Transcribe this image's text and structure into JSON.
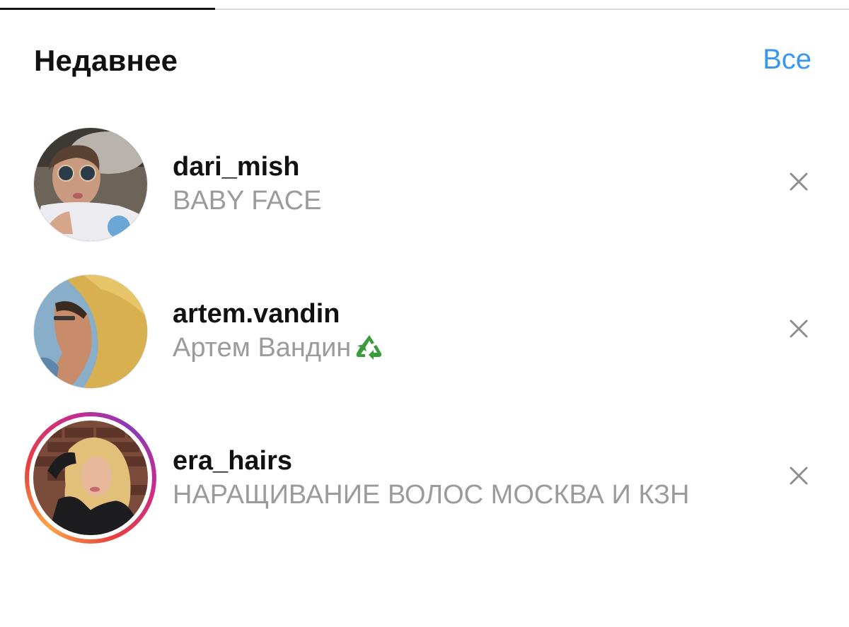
{
  "header": {
    "title": "Недавнее",
    "see_all_label": "Все"
  },
  "recent_items": [
    {
      "username": "dari_mish",
      "full_name": "BABY FACE",
      "has_story_ring": false
    },
    {
      "username": "artem.vandin",
      "full_name": "Артем Вандин",
      "name_emoji": "recycle-icon",
      "has_story_ring": false
    },
    {
      "username": "era_hairs",
      "full_name": "НАРАЩИВАНИЕ ВОЛОС МОСКВА И КЗН",
      "has_story_ring": true
    }
  ],
  "icons": {
    "remove": "close-icon",
    "name_emoji": "recycle-icon"
  },
  "colors": {
    "accent_link": "#3897f0",
    "secondary_text": "#9b9b9b",
    "primary_text": "#111111",
    "close_icon": "#8e8e8e",
    "story_ring_start": "#f9a446",
    "story_ring_end": "#c92c8a"
  }
}
